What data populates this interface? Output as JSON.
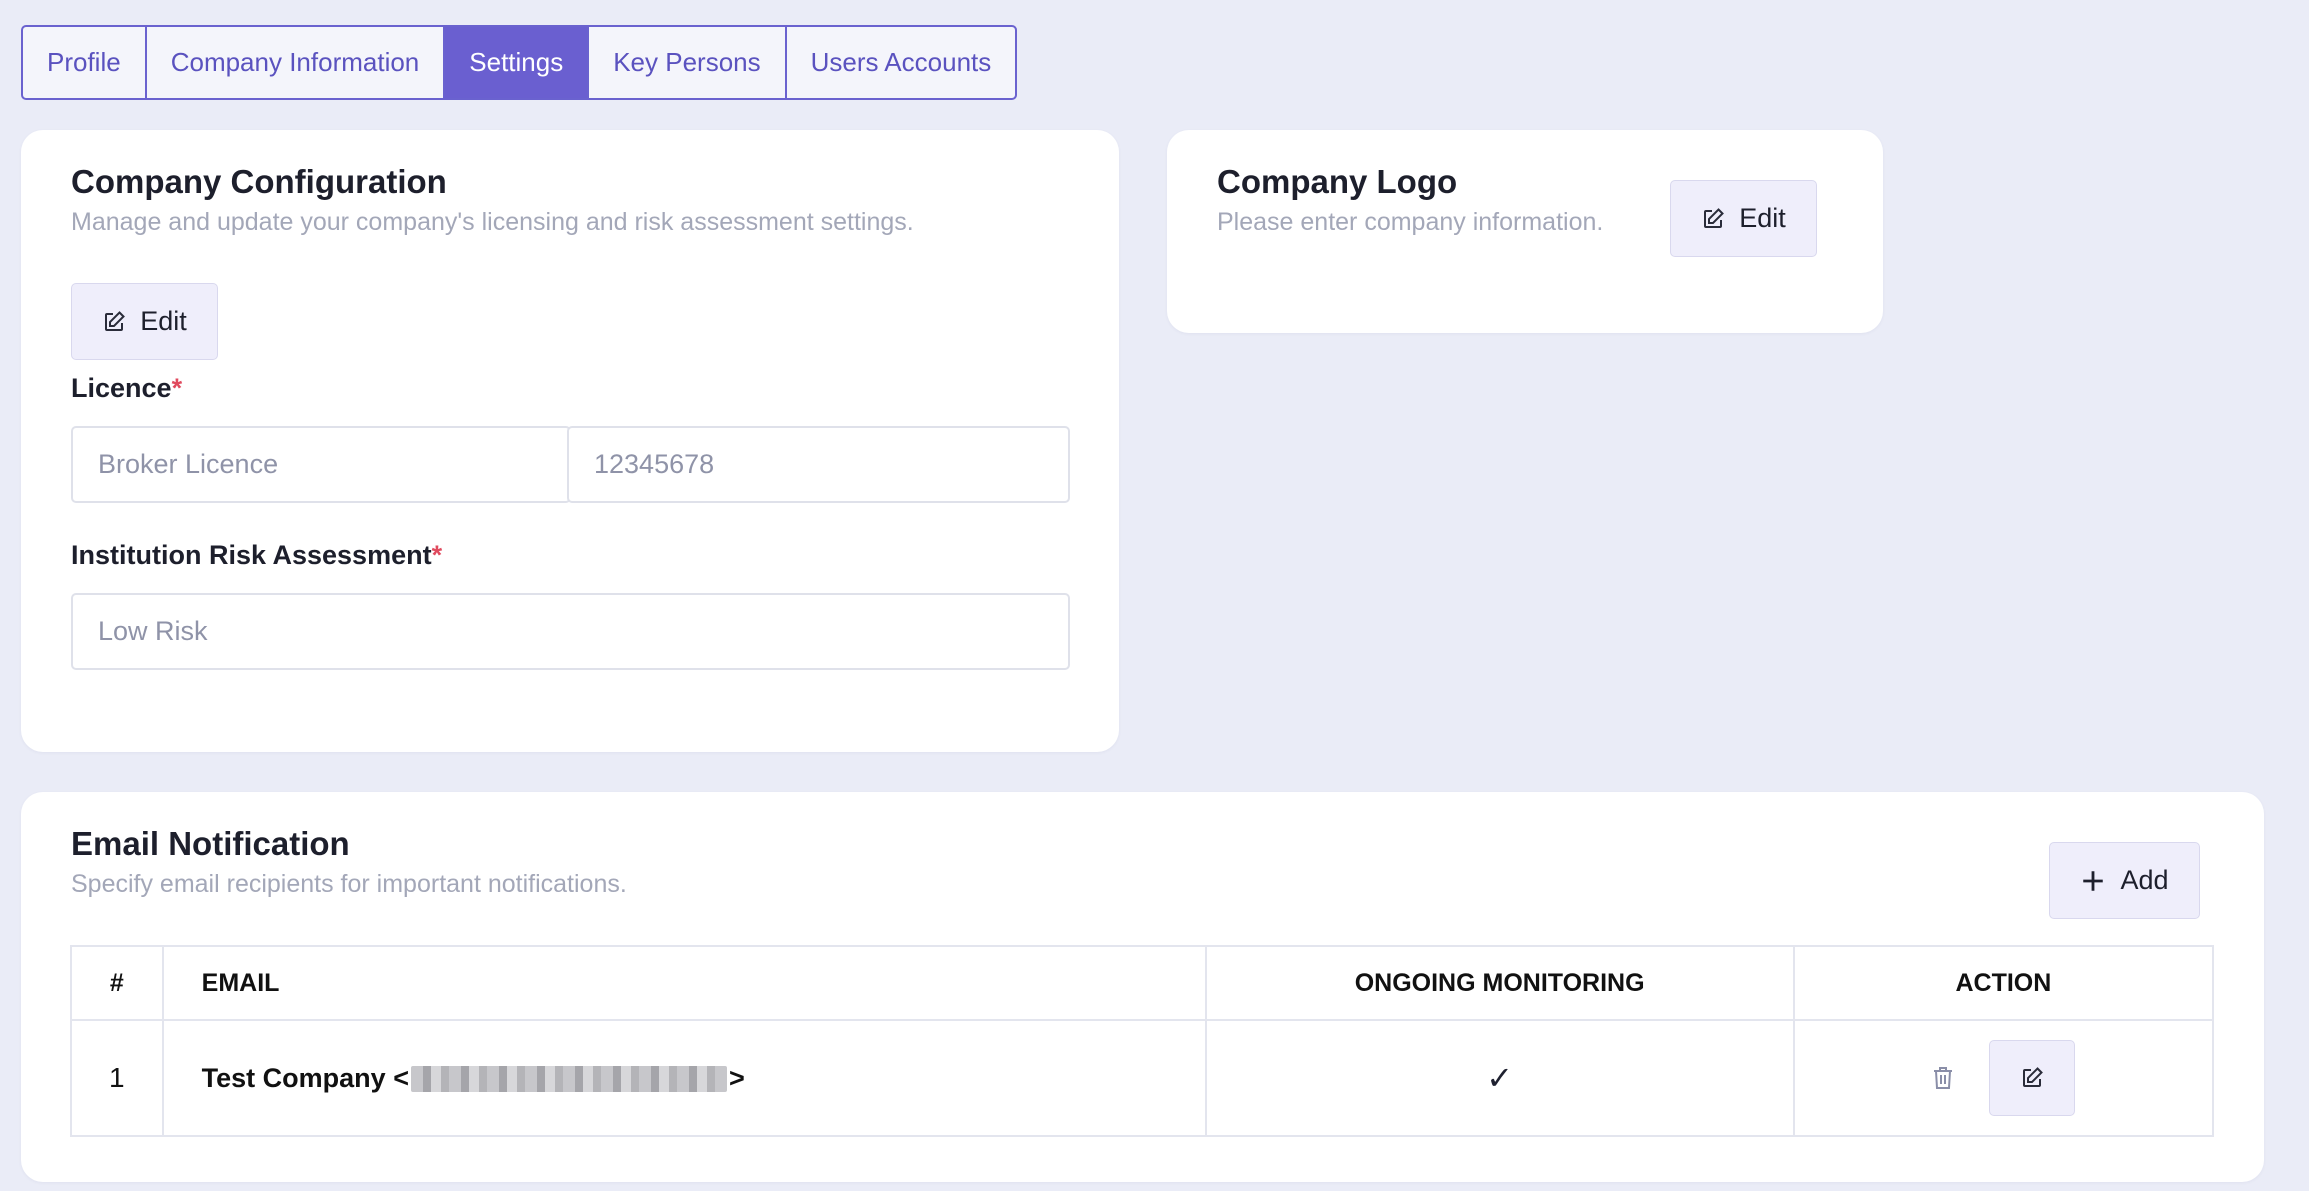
{
  "tabs": [
    {
      "label": "Profile"
    },
    {
      "label": "Company Information"
    },
    {
      "label": "Settings"
    },
    {
      "label": "Key Persons"
    },
    {
      "label": "Users Accounts"
    }
  ],
  "company_config": {
    "title": "Company Configuration",
    "subtitle": "Manage and update your company's licensing and risk assessment settings.",
    "edit_label": "Edit",
    "licence_label": "Licence",
    "licence_type_placeholder": "Broker Licence",
    "licence_number_placeholder": "12345678",
    "risk_label": "Institution Risk Assessment",
    "risk_placeholder": "Low Risk",
    "required_mark": "*"
  },
  "company_logo": {
    "title": "Company Logo",
    "subtitle": "Please enter company information.",
    "edit_label": "Edit"
  },
  "email_notification": {
    "title": "Email Notification",
    "subtitle": "Specify email recipients for important notifications.",
    "add_label": "Add",
    "columns": [
      "#",
      "EMAIL",
      "ONGOING MONITORING",
      "ACTION"
    ],
    "rows": [
      {
        "num": "1",
        "name": "Test Company <",
        "name_end": ">",
        "monitoring": "✓"
      }
    ]
  },
  "colors": {
    "accent": "#6a5fd0",
    "background": "#eaecf7",
    "required": "#e04a5e"
  }
}
